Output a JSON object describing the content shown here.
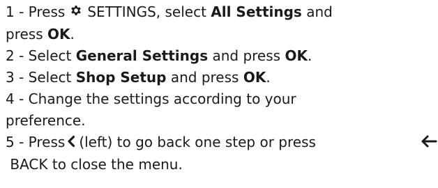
{
  "steps": [
    {
      "num": "1 -",
      "press": "Press",
      "settings_key": "SETTINGS, select",
      "all_settings": "All Settings",
      "and": "and",
      "press2": "press",
      "ok": "OK",
      "end": "."
    },
    {
      "num": "2 -",
      "select": "Select",
      "target": "General Settings",
      "and_press": "and press",
      "ok": "OK",
      "end": "."
    },
    {
      "num": "3 -",
      "select": "Select",
      "target": "Shop Setup",
      "and_press": "and press",
      "ok": "OK",
      "end": "."
    },
    {
      "num": "4 -",
      "text_a": "Change the settings according to your",
      "text_b": "preference."
    },
    {
      "num": "5 -",
      "press": "Press",
      "left_text": "(left) to go back one step or press",
      "back_text": "BACK to close the menu."
    }
  ],
  "icons": {
    "gear": "gear-icon",
    "chevron_left": "chevron-left-icon",
    "arrow_left": "arrow-left-icon"
  }
}
